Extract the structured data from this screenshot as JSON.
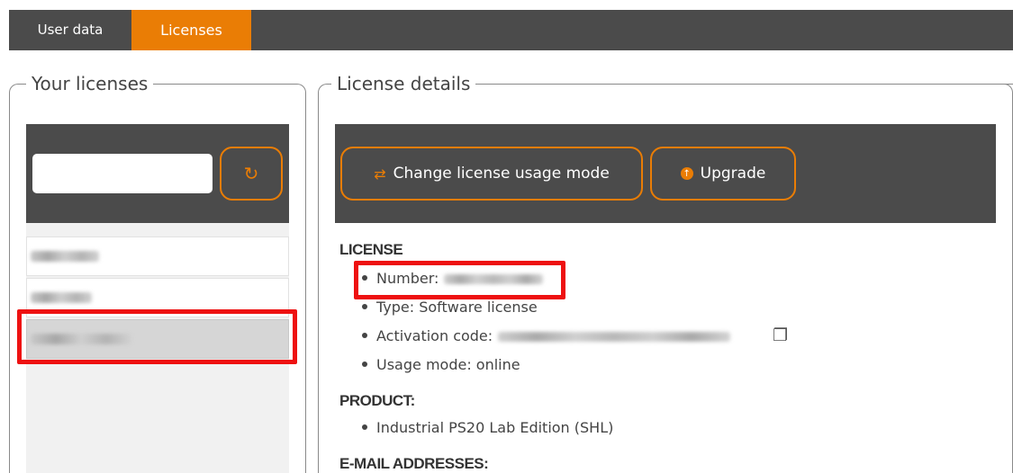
{
  "tabs": [
    {
      "label": "User data",
      "active": false
    },
    {
      "label": "Licenses",
      "active": true
    }
  ],
  "left_panel": {
    "legend": "Your licenses",
    "filter_input": {
      "value": "",
      "placeholder": ""
    },
    "refresh_icon": "refresh-icon"
  },
  "right_panel": {
    "legend": "License details",
    "buttons": {
      "change_mode": "Change license usage mode",
      "upgrade": "Upgrade"
    },
    "license_title": "LICENSE",
    "license": {
      "number_label": "Number:",
      "type": "Type: Software license",
      "activation_label": "Activation code:",
      "usage_mode": "Usage mode: online"
    },
    "product_title": "PRODUCT:",
    "product": "Industrial PS20 Lab Edition (SHL)",
    "email_title": "E-MAIL ADDRESSES:"
  },
  "colors": {
    "accent": "#ea7d05",
    "toolbar": "#4b4b4b",
    "highlight": "#ee1111"
  }
}
